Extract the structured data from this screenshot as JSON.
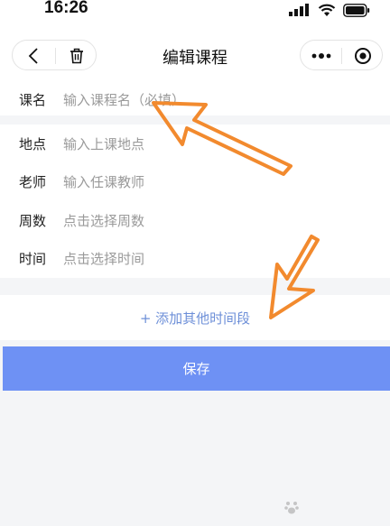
{
  "status_bar": {
    "time": "16:26"
  },
  "navbar": {
    "title": "编辑课程",
    "back_icon": "chevron-left-icon",
    "delete_icon": "trash-icon",
    "more_icon": "more-dots-icon",
    "close_icon": "target-icon"
  },
  "form": {
    "course_name": {
      "label": "课名",
      "placeholder": "输入课程名（必填）"
    },
    "fields": [
      {
        "label": "地点",
        "placeholder": "输入上课地点"
      },
      {
        "label": "老师",
        "placeholder": "输入任课教师"
      },
      {
        "label": "周数",
        "placeholder": "点击选择周数"
      },
      {
        "label": "时间",
        "placeholder": "点击选择时间"
      }
    ]
  },
  "add_time_label": "+ 添加其他时间段",
  "save_label": "保存",
  "colors": {
    "accent": "#6e91f4",
    "link": "#6d8fd8",
    "annotation": "#f28a2e"
  }
}
